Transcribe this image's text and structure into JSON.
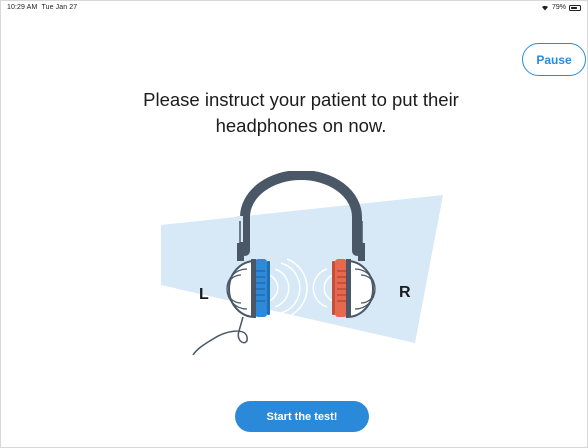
{
  "status_bar": {
    "time": "10:29 AM",
    "date": "Tue Jan 27",
    "battery_text": "79%",
    "battery_level": 0.79
  },
  "pause_label": "Pause",
  "instruction": "Please instruct your patient to put their headphones on now.",
  "illustration": {
    "left_label": "L",
    "right_label": "R",
    "left_color": "#2e8ad8",
    "right_color": "#e8684f",
    "band_color": "#4a5767",
    "beam_color": "#d7e8f7"
  },
  "start_label": "Start the test!",
  "colors": {
    "accent": "#2a8ad9"
  }
}
